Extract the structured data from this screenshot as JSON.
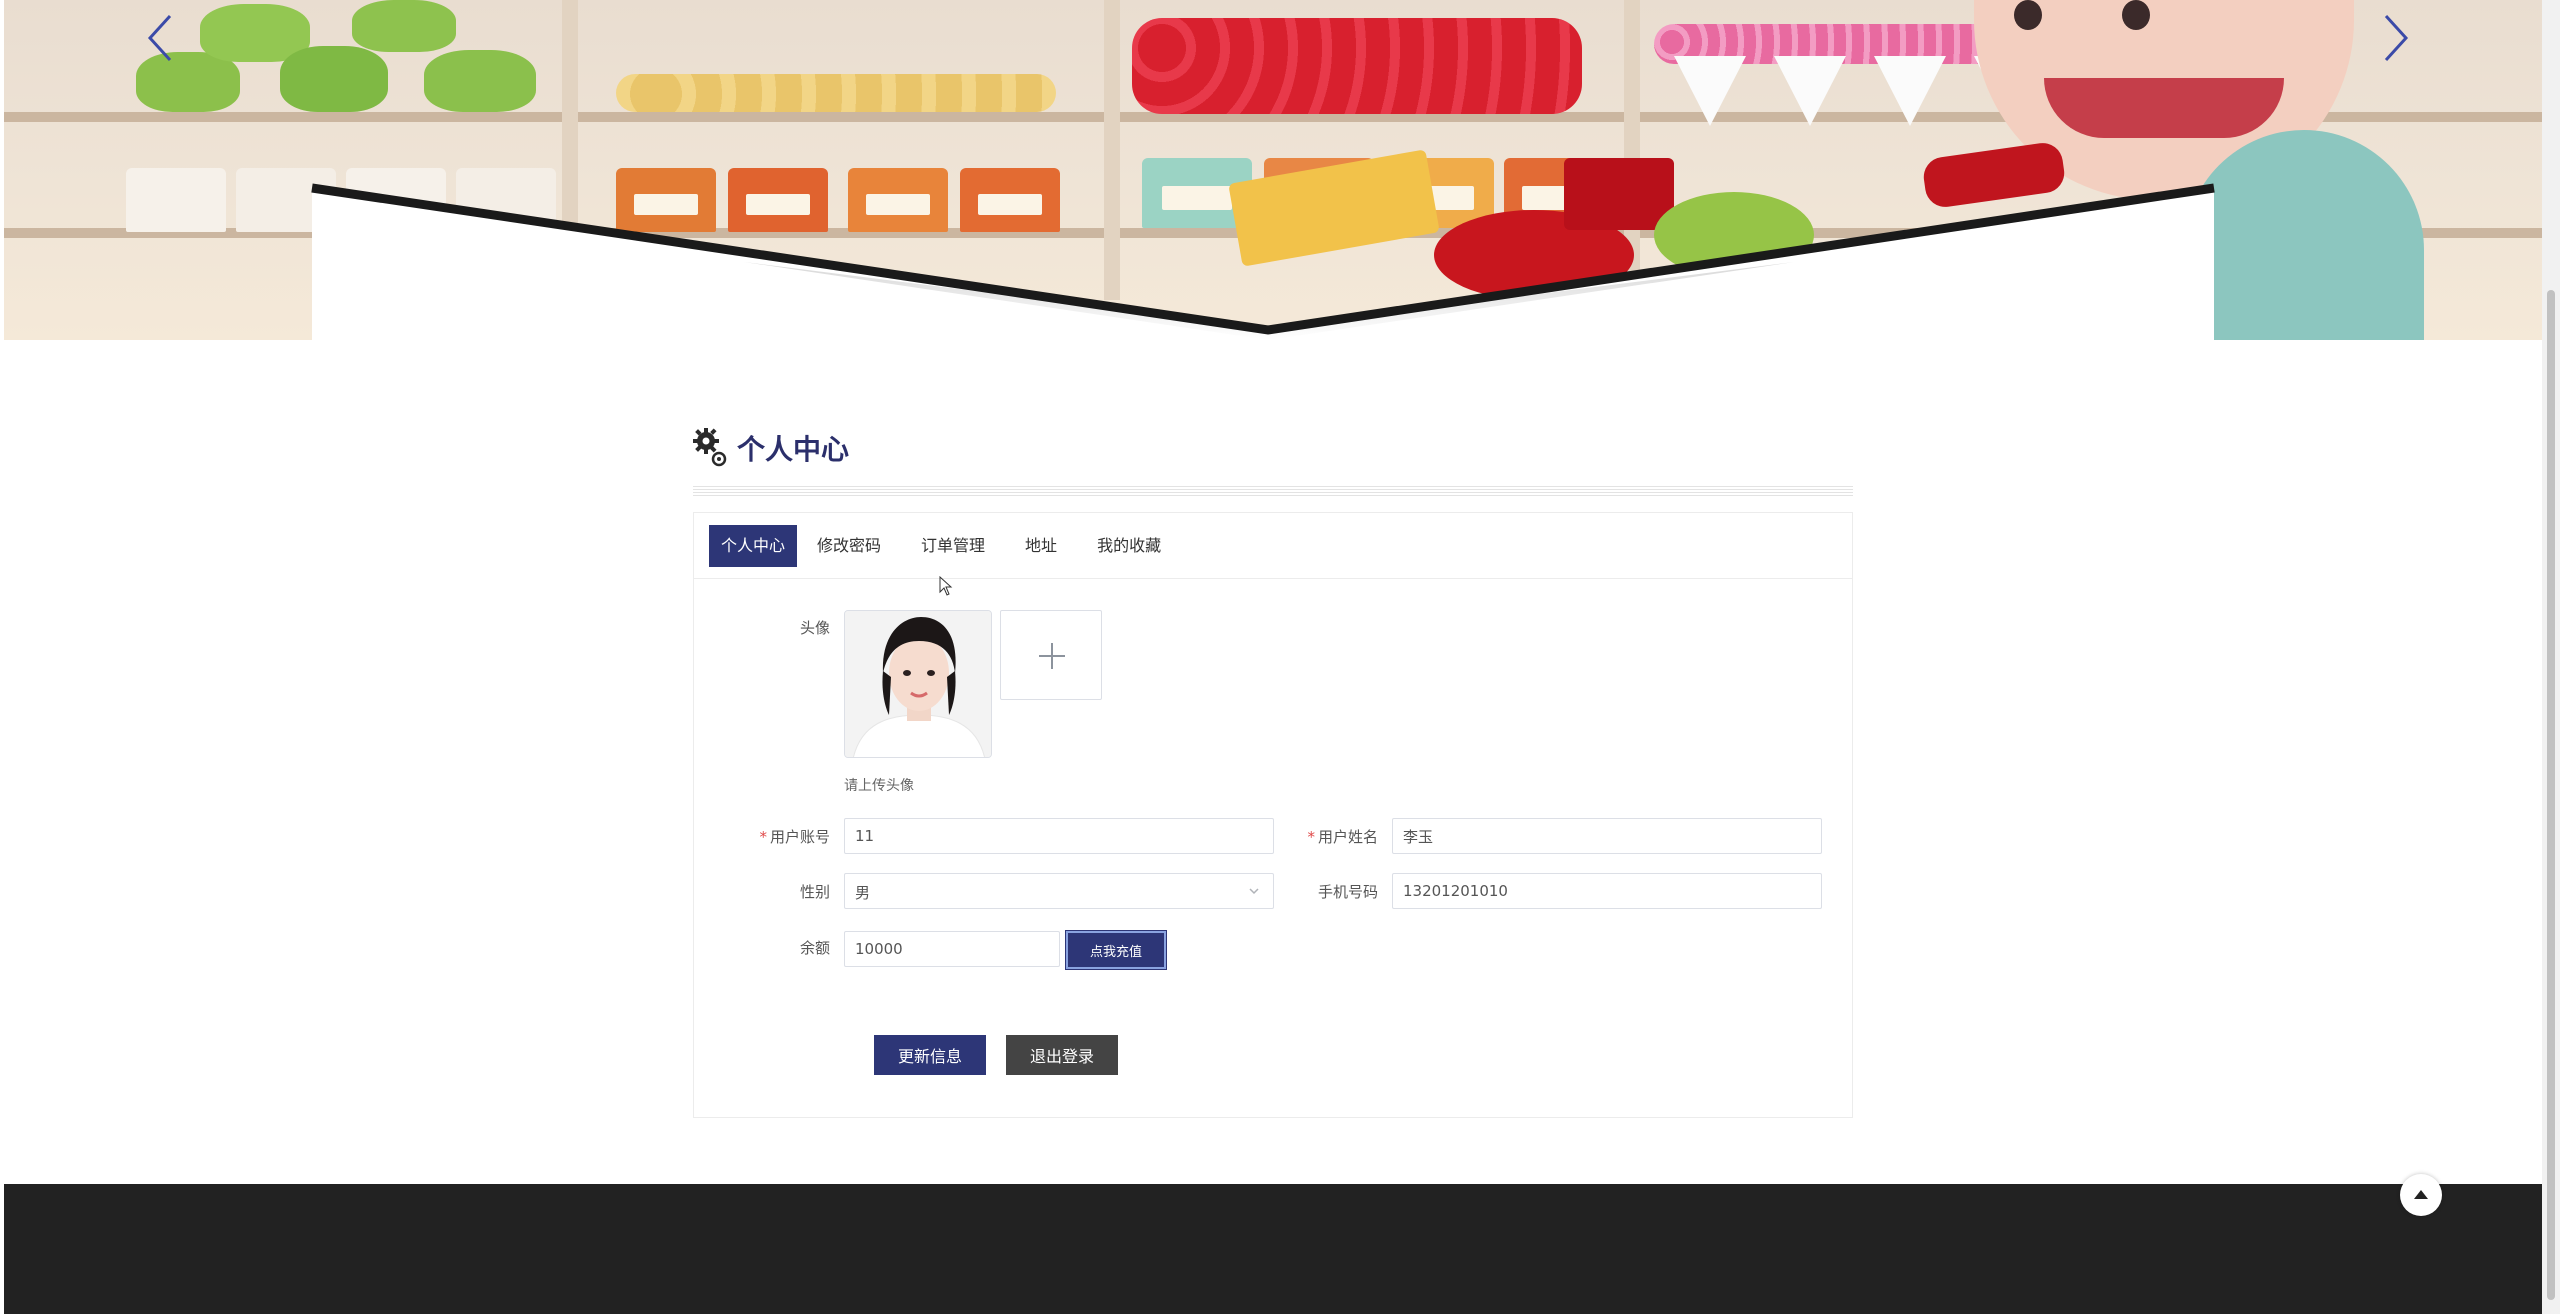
{
  "section": {
    "title": "个人中心"
  },
  "tabs": [
    {
      "label": "个人中心",
      "active": true
    },
    {
      "label": "修改密码",
      "active": false
    },
    {
      "label": "订单管理",
      "active": false
    },
    {
      "label": "地址",
      "active": false
    },
    {
      "label": "我的收藏",
      "active": false
    }
  ],
  "form": {
    "avatar_label": "头像",
    "upload_hint": "请上传头像",
    "account_label": "用户账号",
    "account_value": "11",
    "name_label": "用户姓名",
    "name_value": "李玉",
    "gender_label": "性别",
    "gender_value": "男",
    "phone_label": "手机号码",
    "phone_value": "13201201010",
    "balance_label": "余额",
    "balance_value": "10000",
    "recharge_label": "点我充值"
  },
  "actions": {
    "update_label": "更新信息",
    "logout_label": "退出登录"
  },
  "colors": {
    "primary": "#2d3677",
    "logout": "#444444",
    "footer": "#222222",
    "required": "#e04a4a"
  }
}
